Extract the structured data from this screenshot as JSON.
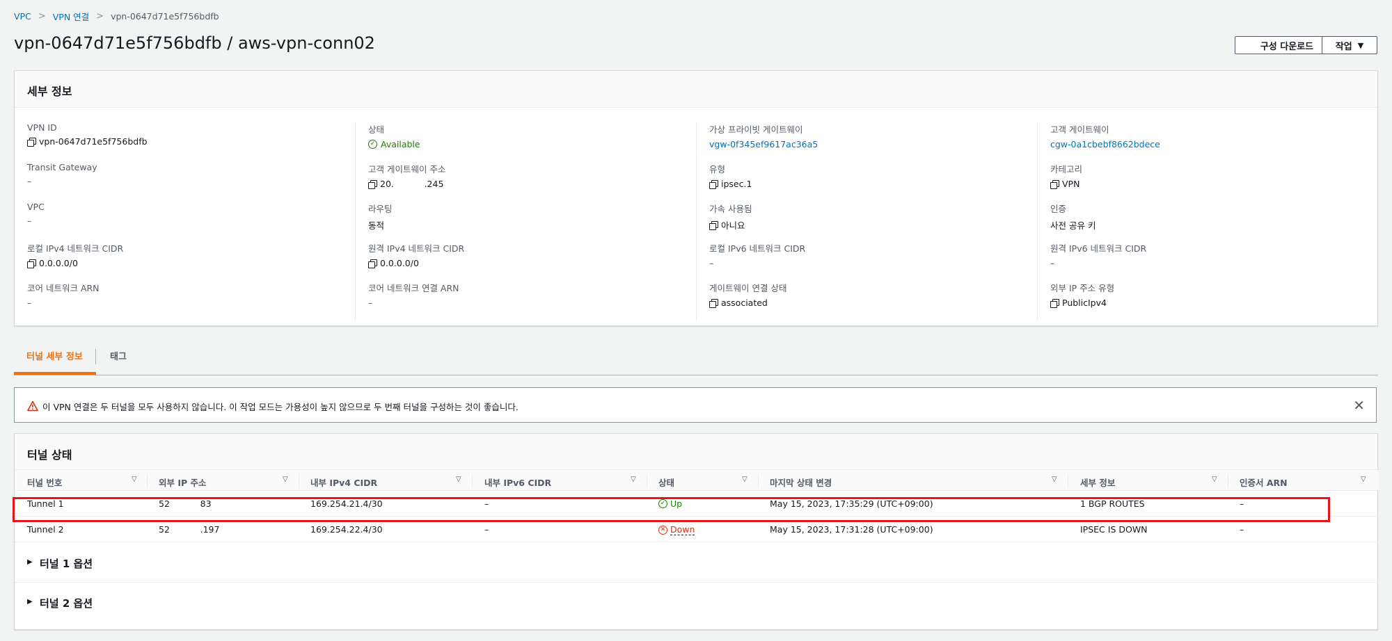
{
  "breadcrumb": {
    "vpc": "VPC",
    "vpn": "VPN 연결",
    "current": "vpn-0647d71e5f756bdfb"
  },
  "page_title": "vpn-0647d71e5f756bdfb / aws-vpn-conn02",
  "buttons": {
    "download": "구성 다운로드",
    "actions": "작업"
  },
  "details": {
    "title": "세부 정보",
    "col1": [
      {
        "label": "VPN ID",
        "value": "vpn-0647d71e5f756bdfb"
      },
      {
        "label": "Transit Gateway",
        "value": "–"
      },
      {
        "label": "VPC",
        "value": "–"
      },
      {
        "label": "로컬 IPv4 네트워크 CIDR",
        "value": "0.0.0.0/0"
      },
      {
        "label": "코어 네트워크 ARN",
        "value": "–"
      }
    ],
    "col2": [
      {
        "label": "상태",
        "value": "Available"
      },
      {
        "label": "고객 게이트웨이 주소",
        "value": "20.           .245"
      },
      {
        "label": "라우팅",
        "value": "동적"
      },
      {
        "label": "원격 IPv4 네트워크 CIDR",
        "value": "0.0.0.0/0"
      },
      {
        "label": "코어 네트워크 연결 ARN",
        "value": "–"
      }
    ],
    "col3": [
      {
        "label": "가상 프라이빗 게이트웨이",
        "value": "vgw-0f345ef9617ac36a5"
      },
      {
        "label": "유형",
        "value": "ipsec.1"
      },
      {
        "label": "가속 사용됨",
        "value": "아니요"
      },
      {
        "label": "로컬 IPv6 네트워크 CIDR",
        "value": "–"
      },
      {
        "label": "게이트웨이 연결 상태",
        "value": "associated"
      }
    ],
    "col4": [
      {
        "label": "고객 게이트웨이",
        "value": "cgw-0a1cbebf8662bdece"
      },
      {
        "label": "카테고리",
        "value": "VPN"
      },
      {
        "label": "인증",
        "value": "사전 공유 키"
      },
      {
        "label": "원격 IPv6 네트워크 CIDR",
        "value": "–"
      },
      {
        "label": "외부 IP 주소 유형",
        "value": "PublicIpv4"
      }
    ]
  },
  "tabs": {
    "tunnel_details": "터널 세부 정보",
    "tags": "태그"
  },
  "alert": {
    "text": "이 VPN 연결은 두 터널을 모두 사용하지 않습니다. 이 작업 모드는 가용성이 높지 않으므로 두 번째 터널을 구성하는 것이 좋습니다."
  },
  "tunnel_status": {
    "title": "터널 상태",
    "columns": [
      "터널 번호",
      "외부 IP 주소",
      "내부 IPv4 CIDR",
      "내부 IPv6 CIDR",
      "상태",
      "마지막 상태 변경",
      "세부 정보",
      "인증서 ARN"
    ],
    "rows": [
      {
        "number": "Tunnel 1",
        "outside_ip": "52           83",
        "inside_ipv4": "169.254.21.4/30",
        "inside_ipv6": "–",
        "status": "Up",
        "last_change": "May 15, 2023, 17:35:29 (UTC+09:00)",
        "details": "1 BGP ROUTES",
        "cert_arn": "–"
      },
      {
        "number": "Tunnel 2",
        "outside_ip": "52           .197",
        "inside_ipv4": "169.254.22.4/30",
        "inside_ipv6": "–",
        "status": "Down",
        "last_change": "May 15, 2023, 17:31:28 (UTC+09:00)",
        "details": "IPSEC IS DOWN",
        "cert_arn": "–"
      }
    ]
  },
  "expanders": {
    "tunnel1": "터널 1 옵션",
    "tunnel2": "터널 2 옵션"
  },
  "colors": {
    "link": "#0073bb",
    "accent": "#ec7211",
    "ok": "#1d8102",
    "error": "#d13212",
    "highlight": "#e8141b"
  }
}
